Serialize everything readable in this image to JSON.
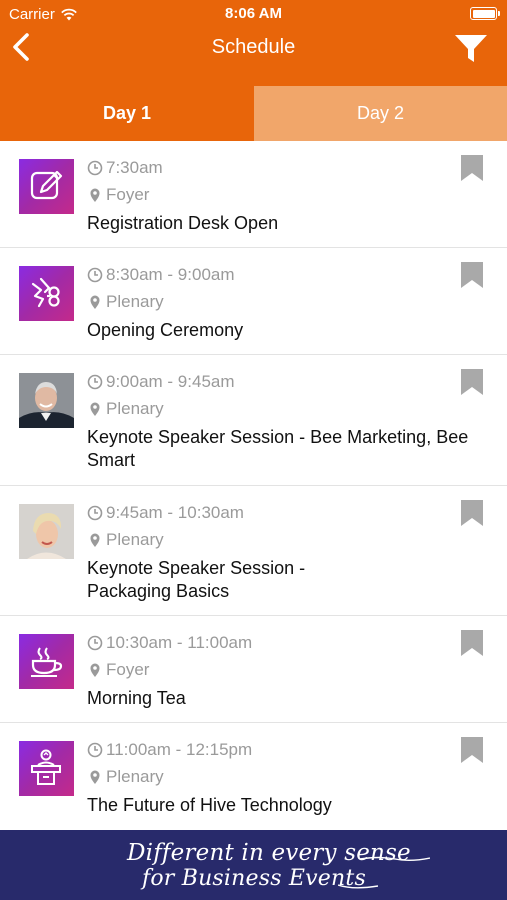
{
  "status_bar": {
    "carrier": "Carrier",
    "time": "8:06 AM"
  },
  "nav": {
    "title": "Schedule",
    "back_icon": "chevron-left-icon",
    "filter_icon": "filter-icon"
  },
  "tabs": [
    {
      "label": "Day 1",
      "selected": true
    },
    {
      "label": "Day 2",
      "selected": false
    }
  ],
  "colors": {
    "primary": "#e8650a",
    "tab_inactive": "#f1a66a",
    "banner": "#282a6b",
    "meta_text": "#9a9a9a"
  },
  "sessions": [
    {
      "time": "7:30am",
      "location": "Foyer",
      "title": "Registration Desk Open",
      "icon": "edit-icon"
    },
    {
      "time": "8:30am - 9:00am",
      "location": "Plenary",
      "title": "Opening Ceremony",
      "icon": "ceremony-icon"
    },
    {
      "time": "9:00am - 9:45am",
      "location": "Plenary",
      "title": "Keynote Speaker Session - Bee Marketing, Bee Smart",
      "icon": "speaker-photo-male"
    },
    {
      "time": "9:45am - 10:30am",
      "location": "Plenary",
      "title": "Keynote Speaker Session - Packaging Basics",
      "icon": "speaker-photo-female"
    },
    {
      "time": "10:30am - 11:00am",
      "location": "Foyer",
      "title": "Morning Tea",
      "icon": "coffee-cup-icon"
    },
    {
      "time": "11:00am - 12:15pm",
      "location": "Plenary",
      "title": "The Future of Hive Technology",
      "icon": "podium-icon"
    }
  ],
  "banner": {
    "line1": "Different in every sense",
    "line2": "for Business Events"
  }
}
